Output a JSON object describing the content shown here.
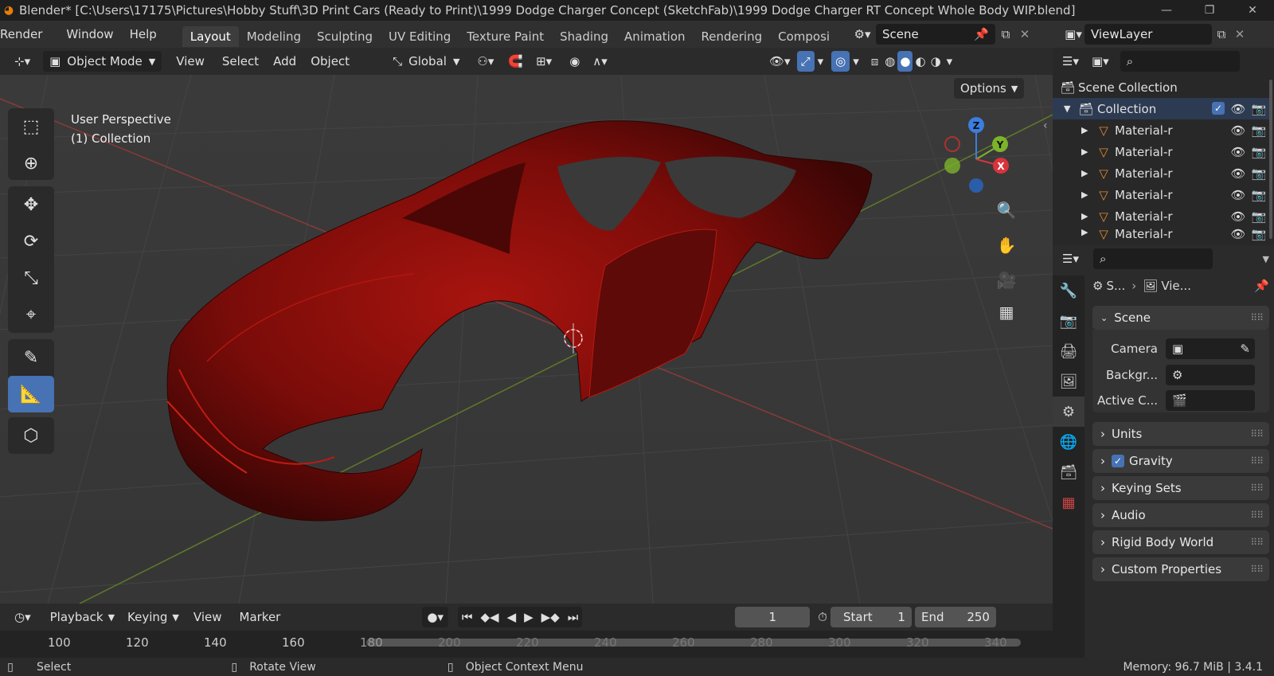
{
  "window": {
    "title": "Blender* [C:\\Users\\17175\\Pictures\\Hobby Stuff\\3D Print Cars (Ready to Print)\\1999 Dodge Charger Concept (SketchFab)\\1999 Dodge Charger RT Concept Whole Body WIP.blend]",
    "minimize": "—",
    "maximize": "❐",
    "close": "✕"
  },
  "menus": [
    "Render",
    "Window",
    "Help"
  ],
  "workspace_tabs": [
    "Layout",
    "Modeling",
    "Sculpting",
    "UV Editing",
    "Texture Paint",
    "Shading",
    "Animation",
    "Rendering",
    "Composi"
  ],
  "scene": {
    "name": "Scene"
  },
  "viewlayer": {
    "name": "ViewLayer"
  },
  "viewport_header": {
    "mode": "Object Mode",
    "menus": [
      "View",
      "Select",
      "Add",
      "Object"
    ],
    "orientation": "Global",
    "options": "Options"
  },
  "viewport": {
    "perspective": "User Perspective",
    "collection": "(1) Collection",
    "gizmo": {
      "z": "Z",
      "y": "Y",
      "x": "X"
    },
    "model_color": "#8a0f0c"
  },
  "outliner": {
    "root": "Scene Collection",
    "collection": "Collection",
    "items": [
      "Material-r",
      "Material-r",
      "Material-r",
      "Material-r",
      "Material-r",
      "Material-r"
    ]
  },
  "properties": {
    "breadcrumb_scene": "S...",
    "breadcrumb_view": "Vie...",
    "scene_panel": "Scene",
    "camera_label": "Camera",
    "background_label": "Backgr...",
    "active_clip_label": "Active C...",
    "panels": [
      "Units",
      "Gravity",
      "Keying Sets",
      "Audio",
      "Rigid Body World",
      "Custom Properties"
    ]
  },
  "timeline": {
    "menus": [
      "Playback",
      "Keying",
      "View",
      "Marker"
    ],
    "current_frame": "1",
    "start_label": "Start",
    "start": "1",
    "end_label": "End",
    "end": "250",
    "ruler": [
      "100",
      "120",
      "140",
      "160",
      "180",
      "200",
      "220",
      "240",
      "260",
      "280",
      "300",
      "320",
      "340"
    ]
  },
  "status": {
    "select": "Select",
    "rotate": "Rotate View",
    "context": "Object Context Menu",
    "memory": "Memory: 96.7 MiB | 3.4.1"
  }
}
